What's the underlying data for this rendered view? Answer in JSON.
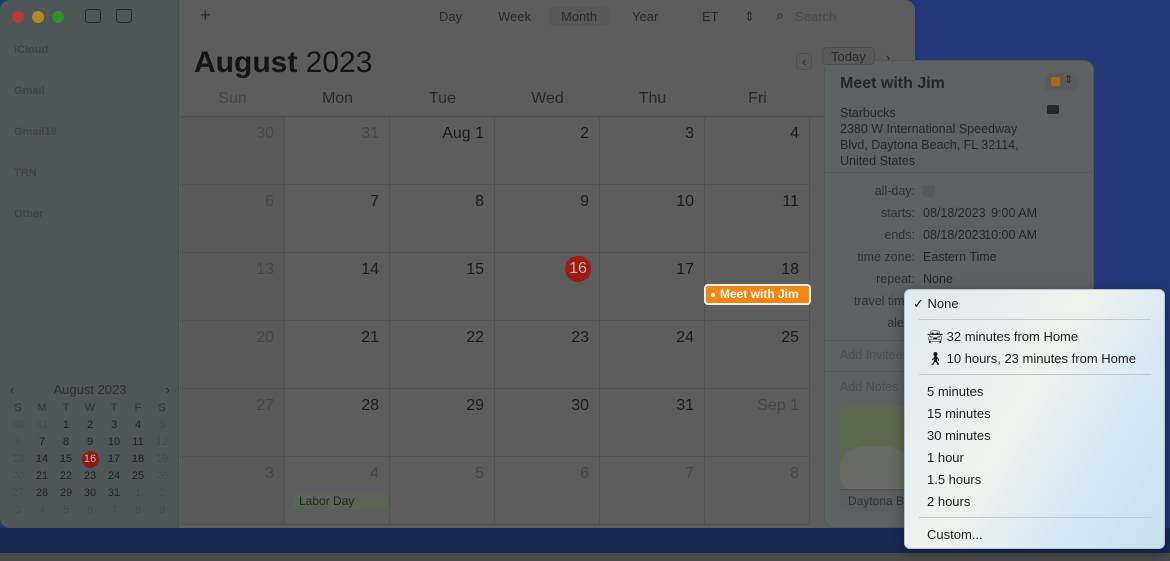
{
  "window": {
    "traffic_lights": [
      "#b73a35",
      "#b18b22",
      "#2e8f2b"
    ]
  },
  "sidebar": {
    "groups": [
      "iCloud",
      "Gmail",
      "Gmail18",
      "TRN",
      "Other"
    ],
    "mini_calendar": {
      "title": "August 2023",
      "weekdays": [
        "S",
        "M",
        "T",
        "W",
        "T",
        "F",
        "S"
      ],
      "weeks": [
        [
          "30",
          "31",
          "1",
          "2",
          "3",
          "4",
          "5"
        ],
        [
          "6",
          "7",
          "8",
          "9",
          "10",
          "11",
          "12"
        ],
        [
          "13",
          "14",
          "15",
          "16",
          "17",
          "18",
          "19"
        ],
        [
          "20",
          "21",
          "22",
          "23",
          "24",
          "25",
          "26"
        ],
        [
          "27",
          "28",
          "29",
          "30",
          "31",
          "1",
          "2"
        ],
        [
          "3",
          "4",
          "5",
          "6",
          "7",
          "8",
          "9"
        ]
      ],
      "today": "16"
    }
  },
  "toolbar": {
    "add": "+",
    "views": [
      "Day",
      "Week",
      "Month",
      "Year"
    ],
    "selected_view": "Month",
    "timezone": "ET",
    "search_placeholder": "Search",
    "today_button": "Today"
  },
  "calendar": {
    "title_month": "August",
    "title_year": "2023",
    "weekdays": [
      "Sun",
      "Mon",
      "Tue",
      "Wed",
      "Thu",
      "Fri"
    ],
    "weeks": [
      [
        "30",
        "31",
        "Aug 1",
        "2",
        "3",
        "4"
      ],
      [
        "6",
        "7",
        "8",
        "9",
        "10",
        "11"
      ],
      [
        "13",
        "14",
        "15",
        "16",
        "17",
        "18"
      ],
      [
        "20",
        "21",
        "22",
        "23",
        "24",
        "25"
      ],
      [
        "27",
        "28",
        "29",
        "30",
        "31",
        "Sep 1"
      ],
      [
        "3",
        "4",
        "5",
        "6",
        "7",
        "8"
      ]
    ],
    "today": "16",
    "events": {
      "meet": "Meet with Jim",
      "labor": "Labor Day"
    },
    "event_color": "#f4850f"
  },
  "popover": {
    "title": "Meet with Jim",
    "location": [
      "Starbucks",
      "2380 W International Speedway",
      "Blvd, Daytona Beach, FL  32114,",
      "United States"
    ],
    "fields": [
      {
        "label": "all-day:",
        "value": ""
      },
      {
        "label": "starts:",
        "value": "08/18/2023",
        "time": "9:00 AM"
      },
      {
        "label": "ends:",
        "value": "08/18/2023",
        "time": "10:00 AM"
      },
      {
        "label": "time zone:",
        "value": "Eastern Time"
      },
      {
        "label": "repeat:",
        "value": "None"
      },
      {
        "label": "travel time:",
        "value": ""
      },
      {
        "label": "alert:",
        "value": ""
      }
    ],
    "add_invitees": "Add Invitees",
    "add_notes": "Add Notes",
    "map_caption": "Daytona Beach"
  },
  "travel_menu": {
    "selected": "None",
    "items_route": [
      {
        "icon": "car-icon",
        "label": "32 minutes from Home"
      },
      {
        "icon": "walk-icon",
        "label": "10 hours, 23 minutes from Home"
      }
    ],
    "items_fixed": [
      "5 minutes",
      "15 minutes",
      "30 minutes",
      "1 hour",
      "1.5 hours",
      "2 hours"
    ],
    "custom": "Custom..."
  }
}
